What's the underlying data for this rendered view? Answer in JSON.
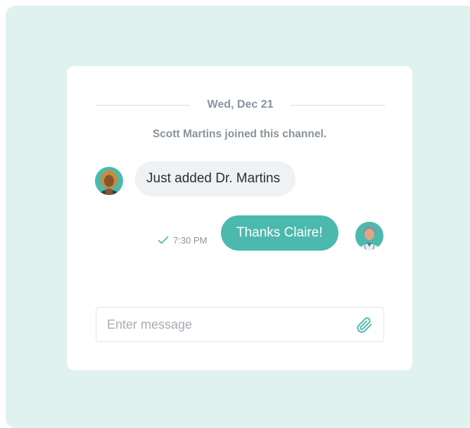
{
  "chat": {
    "date_divider": "Wed, Dec 21",
    "system_message": "Scott Martins joined this channel.",
    "messages": [
      {
        "direction": "incoming",
        "text": "Just added Dr. Martins",
        "avatar_icon": "user-avatar-claire"
      },
      {
        "direction": "outgoing",
        "text": "Thanks Claire!",
        "time": "7:30 PM",
        "status_icon": "checkmark-icon",
        "avatar_icon": "user-avatar-scott"
      }
    ]
  },
  "composer": {
    "placeholder": "Enter message",
    "value": "",
    "attach_icon": "paperclip-icon"
  },
  "colors": {
    "backdrop": "#dff2f0",
    "accent": "#4cb9ad",
    "incoming_bubble": "#f0f1f2",
    "muted_text": "#8a939c"
  }
}
